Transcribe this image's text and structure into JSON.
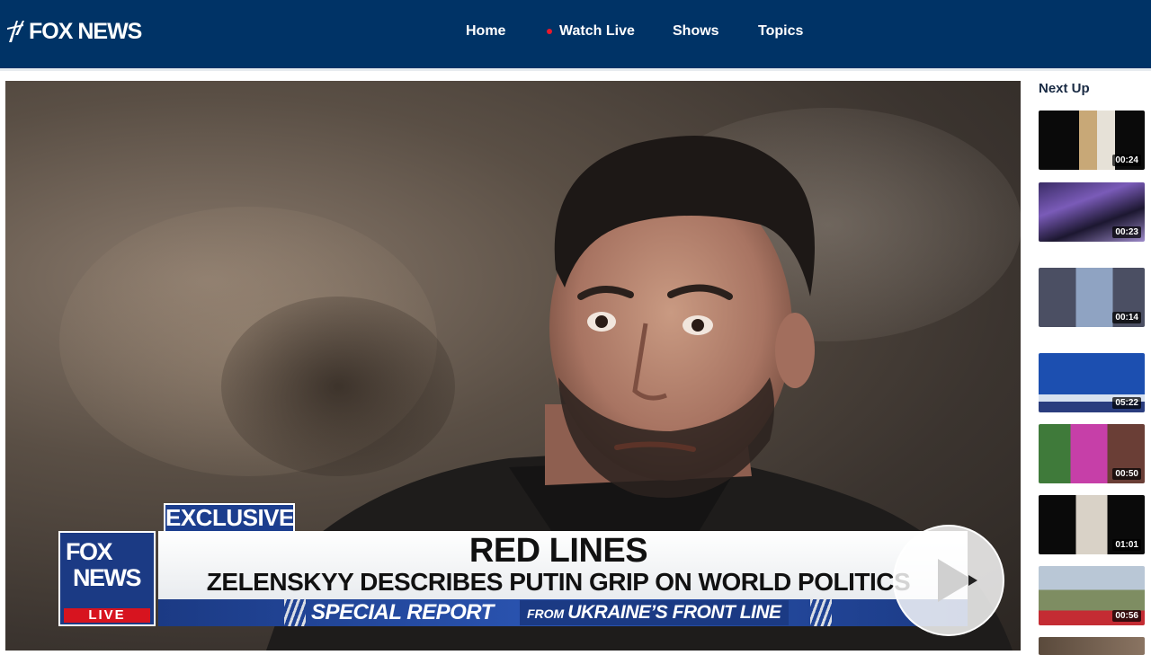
{
  "header": {
    "logo_text": "FOX NEWS",
    "nav": [
      {
        "label": "Home"
      },
      {
        "label": "Watch Live"
      },
      {
        "label": "Shows"
      },
      {
        "label": "Topics"
      }
    ],
    "live_dot_color": "#e8192c",
    "background_color": "#003366"
  },
  "video": {
    "exclusive_label": "EXCLUSIVE",
    "logo": {
      "line1": "FOX",
      "line2": "NEWS",
      "live": "LIVE"
    },
    "headline": "RED LINES",
    "subheadline": "ZELENSKYY DESCRIBES PUTIN GRIP ON WORLD POLITICS",
    "strip_left": "SPECIAL REPORT",
    "strip_right_small": "FROM",
    "strip_right_big": "UKRAINE’S FRONT LINE",
    "play_icon": "play-icon"
  },
  "sidebar": {
    "title": "Next Up",
    "items": [
      {
        "duration": "00:24"
      },
      {
        "duration": "00:23"
      },
      {
        "duration": "00:14"
      },
      {
        "duration": "05:22"
      },
      {
        "duration": "00:50"
      },
      {
        "duration": "01:01"
      },
      {
        "duration": "00:56"
      },
      {
        "duration": ""
      }
    ]
  }
}
